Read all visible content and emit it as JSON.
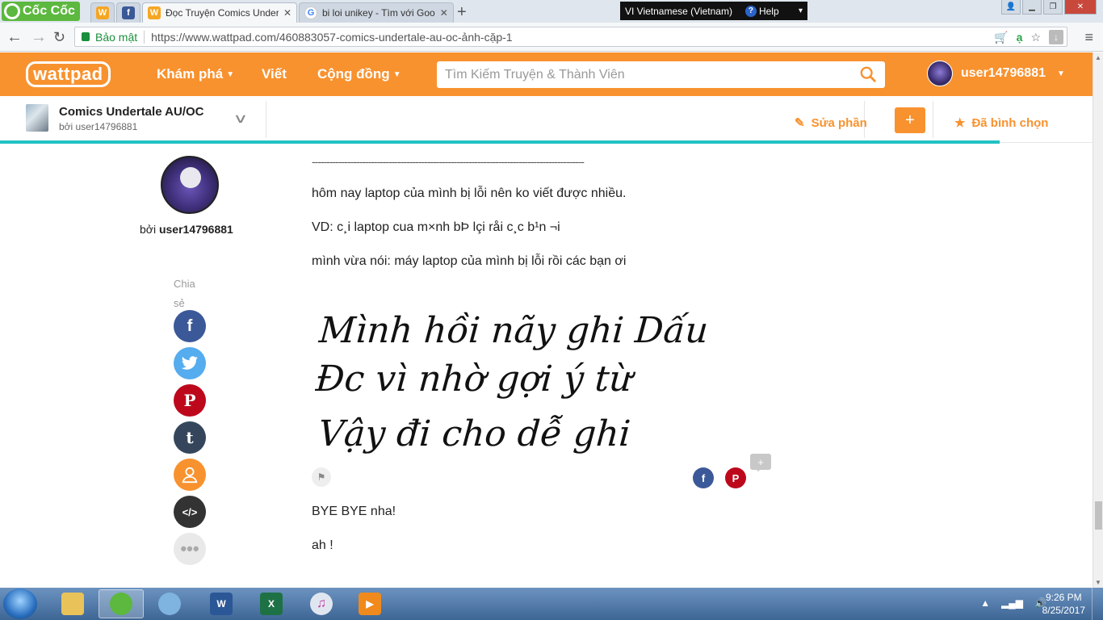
{
  "browser": {
    "brand": "Cốc Cốc",
    "tabs": [
      {
        "title": "Đọc Truyện Comics Under",
        "favicon": "wattpad",
        "active": true
      },
      {
        "title": "bi loi unikey - Tìm với Goo",
        "favicon": "google",
        "active": false
      }
    ],
    "language": "VI  Vietnamese (Vietnam)",
    "help": "Help",
    "security_label": "Bảo mật",
    "url": "https://www.wattpad.com/460883057-comics-undertale-au-oc-ảnh-cặp-1"
  },
  "header": {
    "logo": "wattpad",
    "nav": [
      "Khám phá",
      "Viết",
      "Cộng đồng"
    ],
    "search_placeholder": "Tìm Kiếm Truyện & Thành Viên",
    "username": "user14796881"
  },
  "story": {
    "title": "Comics Undertale AU/OC",
    "byline": "bởi user14796881",
    "edit_label": "Sửa phần",
    "add_label": "+",
    "vote_label": "Đã bình chọn",
    "progress": 0.915
  },
  "sidebar": {
    "by_prefix": "bởi",
    "author": "user14796881",
    "share_label": "Chia sẻ",
    "share_buttons": [
      "facebook",
      "twitter",
      "pinterest",
      "tumblr",
      "profile",
      "embed",
      "more"
    ]
  },
  "content": {
    "divider": "--------------------------------------------------------------------------------------------",
    "paragraphs": [
      "hôm nay laptop của mình bị lỗi nên ko viết được nhiều.",
      "VD: c¸i laptop cua m×nh bÞ lçi råi c¸c b¹n ¬i",
      " mình vừa nói: máy laptop của mình bị lỗi rồi các bạn ơi"
    ],
    "handwriting_lines": [
      "Mình hồi nãy ghi Dấu",
      "Đc vì nhờ gợi ý từ",
      "Vậy đi cho dễ ghi"
    ],
    "comment_badge": "+",
    "after": [
      "BYE BYE nha!",
      "ah !"
    ]
  },
  "taskbar": {
    "time": "9:26 PM",
    "date": "8/25/2017"
  }
}
